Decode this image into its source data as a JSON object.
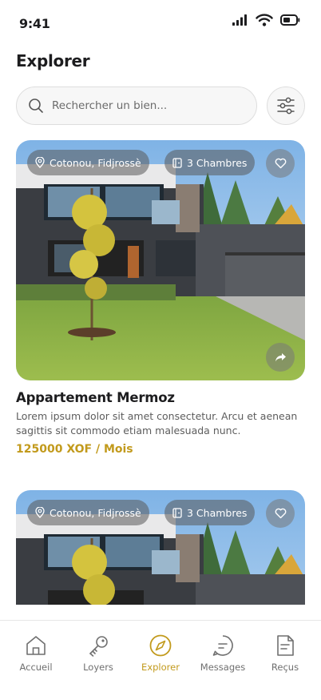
{
  "status_bar": {
    "time": "9:41",
    "icons": [
      "cellular-icon",
      "wifi-icon",
      "battery-icon"
    ]
  },
  "header": {
    "title": "Explorer"
  },
  "search": {
    "placeholder": "Rechercher un bien...",
    "value": ""
  },
  "listings": [
    {
      "location": "Cotonou, Fidjrossè",
      "rooms": "3 Chambres",
      "title": "Appartement Mermoz",
      "description": "Lorem ipsum dolor sit amet consectetur. Arcu et aenean sagittis sit commodo etiam malesuada nunc.",
      "price": "125000 XOF / Mois"
    },
    {
      "location": "Cotonou, Fidjrossè",
      "rooms": "3 Chambres"
    }
  ],
  "nav": {
    "items": [
      {
        "label": "Accueil",
        "icon": "home-icon"
      },
      {
        "label": "Loyers",
        "icon": "key-icon"
      },
      {
        "label": "Explorer",
        "icon": "compass-icon",
        "active": true
      },
      {
        "label": "Messages",
        "icon": "chat-icon"
      },
      {
        "label": "Reçus",
        "icon": "receipt-icon"
      }
    ]
  },
  "colors": {
    "accent": "#c29a1c",
    "text": "#1d1d1f",
    "muted": "#6f6f6f"
  }
}
